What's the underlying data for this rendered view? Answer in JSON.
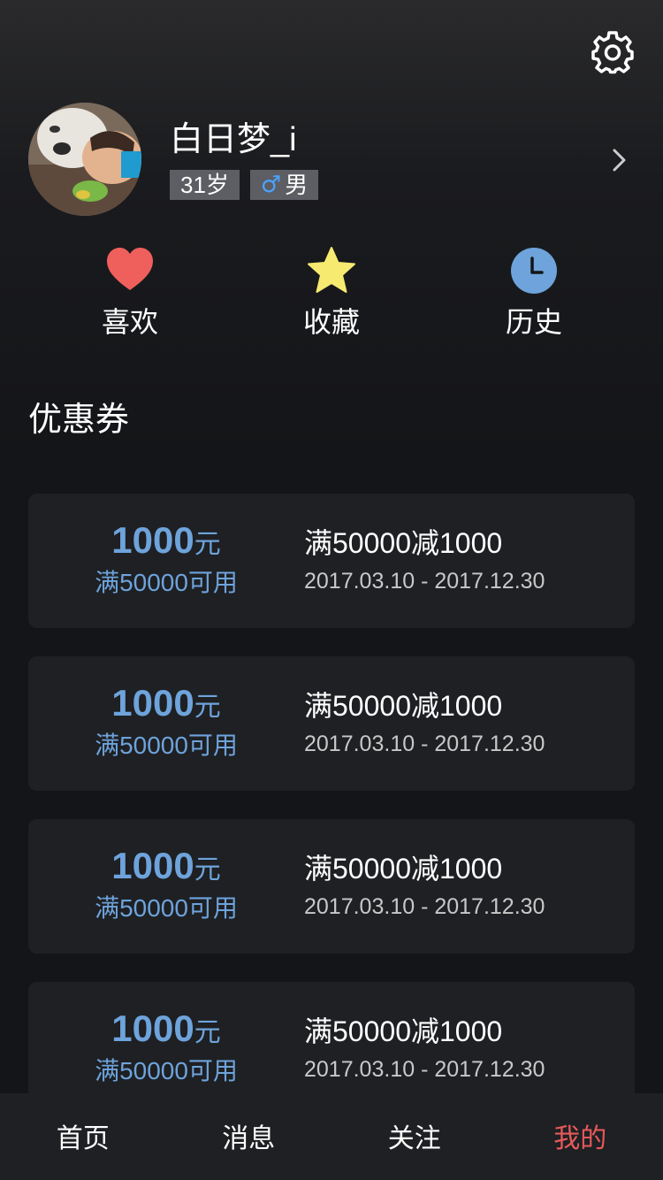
{
  "header": {
    "settings_icon": "gear-icon"
  },
  "profile": {
    "username": "白日梦_i",
    "age_tag": "31岁",
    "gender_symbol": "♂",
    "gender_label": "男",
    "chevron_icon": "chevron-right-icon"
  },
  "shortcuts": [
    {
      "label": "喜欢",
      "icon": "heart-icon",
      "color": "#ef5f5c"
    },
    {
      "label": "收藏",
      "icon": "star-icon",
      "color": "#f6ea70"
    },
    {
      "label": "历史",
      "icon": "clock-icon",
      "color": "#6ea3db"
    }
  ],
  "coupons_section": {
    "title": "优惠券"
  },
  "coupons": [
    {
      "amount": "1000",
      "unit": "元",
      "condition": "满50000可用",
      "title": "满50000减1000",
      "date": "2017.03.10 - 2017.12.30"
    },
    {
      "amount": "1000",
      "unit": "元",
      "condition": "满50000可用",
      "title": "满50000减1000",
      "date": "2017.03.10 - 2017.12.30"
    },
    {
      "amount": "1000",
      "unit": "元",
      "condition": "满50000可用",
      "title": "满50000减1000",
      "date": "2017.03.10 - 2017.12.30"
    },
    {
      "amount": "1000",
      "unit": "元",
      "condition": "满50000可用",
      "title": "满50000减1000",
      "date": "2017.03.10 - 2017.12.30"
    }
  ],
  "tabbar": {
    "items": [
      {
        "label": "首页",
        "active": false
      },
      {
        "label": "消息",
        "active": false
      },
      {
        "label": "关注",
        "active": false
      },
      {
        "label": "我的",
        "active": true
      }
    ],
    "active_color": "#e65a5a"
  },
  "colors": {
    "background": "#141518",
    "card": "#1e2023",
    "accent_blue": "#6ea3db",
    "tag_bg": "#5c5e63"
  }
}
